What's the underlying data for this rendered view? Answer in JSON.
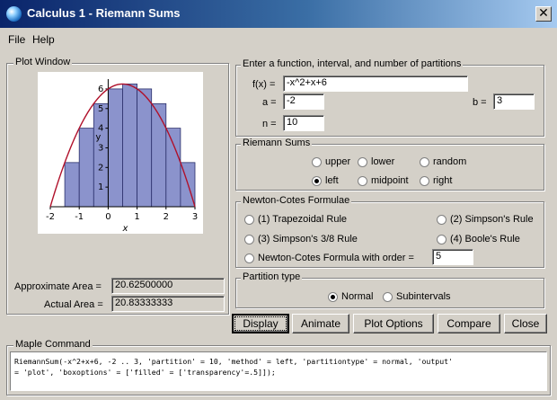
{
  "window": {
    "title": "Calculus 1 - Riemann Sums",
    "close_glyph": "✕"
  },
  "menu": {
    "items": [
      "File",
      "Help"
    ]
  },
  "plot_window": {
    "legend": "Plot Window",
    "y_axis_label": "y",
    "x_axis_label": "x",
    "fill_color": "#8b93cc",
    "curve_color": "#b0102a"
  },
  "chart_data": {
    "type": "bar",
    "function": "-x^2+x+6",
    "xlim": [
      -2,
      3
    ],
    "ylim": [
      0,
      6.5
    ],
    "x_ticks": [
      "-2",
      "-1",
      "0",
      "1",
      "2",
      "3"
    ],
    "y_ticks": [
      "1",
      "2",
      "3",
      "4",
      "5",
      "6"
    ],
    "bars": [
      {
        "left": -2.0,
        "height": 0.0
      },
      {
        "left": -1.5,
        "height": 2.25
      },
      {
        "left": -1.0,
        "height": 4.0
      },
      {
        "left": -0.5,
        "height": 5.25
      },
      {
        "left": 0.0,
        "height": 6.0
      },
      {
        "left": 0.5,
        "height": 6.25
      },
      {
        "left": 1.0,
        "height": 6.0
      },
      {
        "left": 1.5,
        "height": 5.25
      },
      {
        "left": 2.0,
        "height": 4.0
      },
      {
        "left": 2.5,
        "height": 2.25
      }
    ],
    "bar_width": 0.5
  },
  "areas": {
    "approx_label": "Approximate Area =",
    "approx_value": "20.62500000",
    "actual_label": "Actual Area =",
    "actual_value": "20.83333333"
  },
  "inputs": {
    "legend": "Enter a function, interval, and number of partitions",
    "fx_label": "f(x) =",
    "fx_value": "-x^2+x+6",
    "a_label": "a =",
    "a_value": "-2",
    "b_label": "b =",
    "b_value": "3",
    "n_label": "n =",
    "n_value": "10"
  },
  "riemann": {
    "legend": "Riemann Sums",
    "options": [
      "upper",
      "lower",
      "random",
      "left",
      "midpoint",
      "right"
    ],
    "selected": "left"
  },
  "newton_cotes": {
    "legend": "Newton-Cotes Formulae",
    "trapezoidal": "(1) Trapezoidal Rule",
    "simpson": "(2) Simpson's Rule",
    "simpson38": "(3) Simpson's 3/8 Rule",
    "boole": "(4) Boole's Rule",
    "custom": "Newton-Cotes Formula with order =",
    "order_value": "5"
  },
  "partition": {
    "legend": "Partition type",
    "normal": "Normal",
    "subintervals": "Subintervals",
    "selected": "Normal"
  },
  "buttons": {
    "display": "Display",
    "animate": "Animate",
    "plot_options": "Plot Options",
    "compare": "Compare",
    "close": "Close"
  },
  "maple": {
    "legend": "Maple Command",
    "line1": "RiemannSum(-x^2+x+6, -2 .. 3, 'partition' = 10, 'method' = left, 'partitiontype' = normal, 'output'",
    "line2": "= 'plot', 'boxoptions' = ['filled' = ['transparency'=.5]]);"
  }
}
